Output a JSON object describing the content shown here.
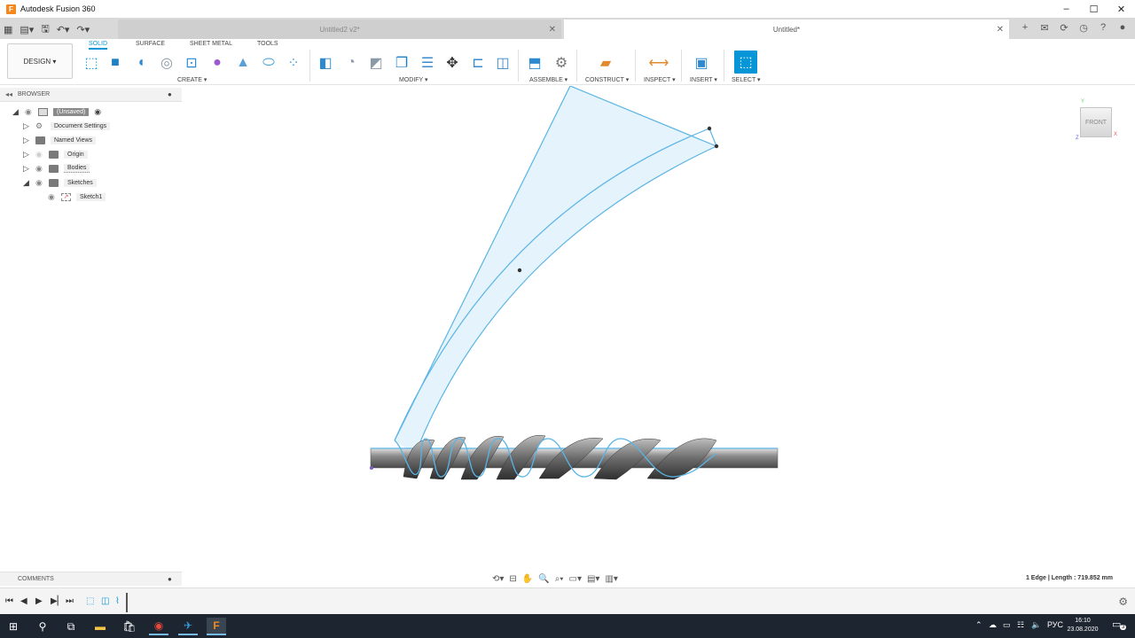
{
  "window": {
    "title": "Autodesk Fusion 360",
    "app_icon_letter": "F",
    "buttons": [
      "–",
      "☐",
      "✕"
    ]
  },
  "tabs": [
    {
      "label": "Untitled2 v2*",
      "active": false
    },
    {
      "label": "Untitled*",
      "active": true
    }
  ],
  "toolbar": {
    "workspace_button": "DESIGN ▾",
    "workspace_tabs": [
      "SOLID",
      "SURFACE",
      "SHEET METAL",
      "TOOLS"
    ],
    "groups": {
      "create": "CREATE ▾",
      "modify": "MODIFY ▾",
      "assemble": "ASSEMBLE ▾",
      "construct": "CONSTRUCT ▾",
      "inspect": "INSPECT ▾",
      "insert": "INSERT ▾",
      "select": "SELECT ▾"
    }
  },
  "browser": {
    "title": "BROWSER",
    "items": [
      {
        "label": "(Unsaved)"
      },
      {
        "label": "Document Settings"
      },
      {
        "label": "Named Views"
      },
      {
        "label": "Origin"
      },
      {
        "label": "Bodies"
      },
      {
        "label": "Sketches"
      },
      {
        "label": "Sketch1"
      }
    ]
  },
  "viewcube": {
    "face": "FRONT",
    "axes": {
      "x": "X",
      "y": "Y",
      "z": "Z"
    }
  },
  "comments": {
    "title": "COMMENTS"
  },
  "status": {
    "selection": "1 Edge | Length : 719.852 mm"
  },
  "taskbar": {
    "language": "РУС",
    "time": "16:10",
    "date": "23.08.2020",
    "notification_count": "3"
  },
  "colors": {
    "accent": "#0696d7",
    "sketch_line": "#5ab4e5",
    "sketch_fill": "#dff1fb",
    "taskbar": "#1c2530"
  }
}
